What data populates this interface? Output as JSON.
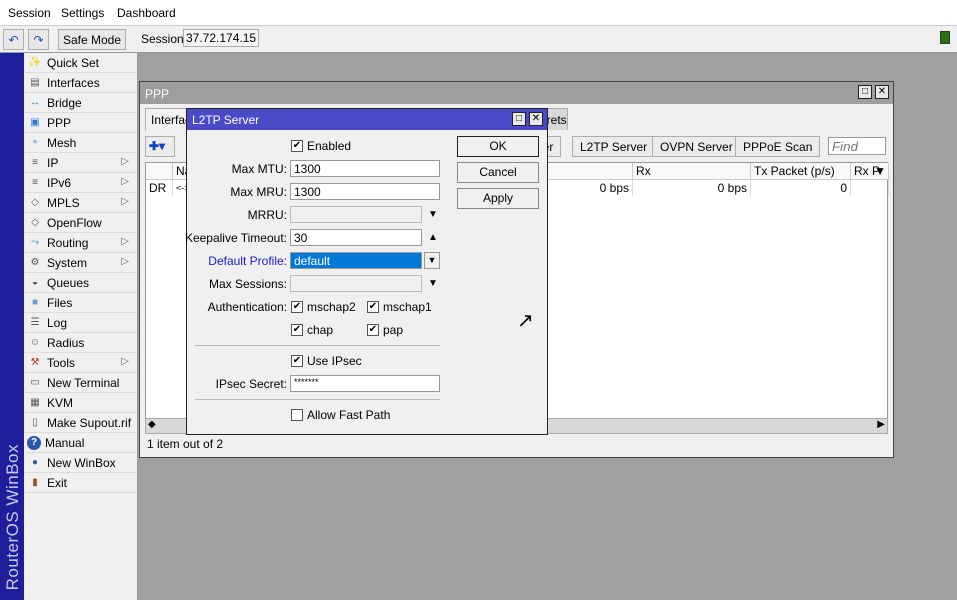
{
  "menu": [
    "Session",
    "Settings",
    "Dashboard"
  ],
  "toolbar": {
    "undo_icon": "undo-icon",
    "redo_icon": "redo-icon",
    "safe_mode": "Safe Mode",
    "session_label": "Session:",
    "session_value": "37.72.174.15",
    "status_color": "#2f6d1a"
  },
  "branding": "RouterOS WinBox",
  "sidebar": [
    {
      "label": "Quick Set",
      "icon": "wand-icon",
      "arrow": false
    },
    {
      "label": "Interfaces",
      "icon": "interface-card-icon",
      "arrow": false
    },
    {
      "label": "Bridge",
      "icon": "bridge-icon",
      "arrow": false
    },
    {
      "label": "PPP",
      "icon": "ppp-icon",
      "arrow": false
    },
    {
      "label": "Mesh",
      "icon": "mesh-icon",
      "arrow": false
    },
    {
      "label": "IP",
      "icon": "ip-icon",
      "arrow": true
    },
    {
      "label": "IPv6",
      "icon": "ipv6-icon",
      "arrow": true
    },
    {
      "label": "MPLS",
      "icon": "mpls-icon",
      "arrow": true
    },
    {
      "label": "OpenFlow",
      "icon": "openflow-icon",
      "arrow": false
    },
    {
      "label": "Routing",
      "icon": "routing-icon",
      "arrow": true
    },
    {
      "label": "System",
      "icon": "gear-icon",
      "arrow": true
    },
    {
      "label": "Queues",
      "icon": "gauge-icon",
      "arrow": false
    },
    {
      "label": "Files",
      "icon": "folder-icon",
      "arrow": false
    },
    {
      "label": "Log",
      "icon": "log-icon",
      "arrow": false
    },
    {
      "label": "Radius",
      "icon": "users-icon",
      "arrow": false
    },
    {
      "label": "Tools",
      "icon": "tools-icon",
      "arrow": true
    },
    {
      "label": "New Terminal",
      "icon": "terminal-icon",
      "arrow": false
    },
    {
      "label": "KVM",
      "icon": "kvm-icon",
      "arrow": false
    },
    {
      "label": "Make Supout.rif",
      "icon": "file-icon",
      "arrow": false
    },
    {
      "label": "Manual",
      "icon": "help-icon",
      "arrow": false
    },
    {
      "label": "New WinBox",
      "icon": "winbox-icon",
      "arrow": false
    },
    {
      "label": "Exit",
      "icon": "door-icon",
      "arrow": false
    }
  ],
  "ppp": {
    "title": "PPP",
    "tabs": [
      "Interface",
      "Secrets"
    ],
    "buttons": [
      "Server",
      "L2TP Server",
      "OVPN Server",
      "PPPoE Scan"
    ],
    "find_placeholder": "Find",
    "columns": [
      "Name",
      "Rx",
      "Tx Packet (p/s)",
      "Rx P"
    ],
    "rows": [
      {
        "flag": "DR",
        "name": "<->",
        "tx": "0 bps",
        "rx": "0 bps",
        "tx_packet": "0",
        "rx_packet": ""
      }
    ],
    "status": "1 item out of 2"
  },
  "dialog": {
    "title": "L2TP Server",
    "enabled_label": "Enabled",
    "enabled": true,
    "max_mtu_label": "Max MTU:",
    "max_mtu": "1300",
    "max_mru_label": "Max MRU:",
    "max_mru": "1300",
    "mrru_label": "MRRU:",
    "mrru": "",
    "keepalive_label": "Keepalive Timeout:",
    "keepalive": "30",
    "default_profile_label": "Default Profile:",
    "default_profile": "default",
    "max_sessions_label": "Max Sessions:",
    "max_sessions": "",
    "auth_label": "Authentication:",
    "auth": [
      {
        "label": "mschap2",
        "checked": true
      },
      {
        "label": "mschap1",
        "checked": true
      },
      {
        "label": "chap",
        "checked": true
      },
      {
        "label": "pap",
        "checked": true
      }
    ],
    "use_ipsec_label": "Use IPsec",
    "use_ipsec": true,
    "ipsec_secret_label": "IPsec Secret:",
    "ipsec_secret": "*******",
    "fast_path_label": "Allow Fast Path",
    "fast_path": false,
    "ok": "OK",
    "cancel": "Cancel",
    "apply": "Apply"
  }
}
